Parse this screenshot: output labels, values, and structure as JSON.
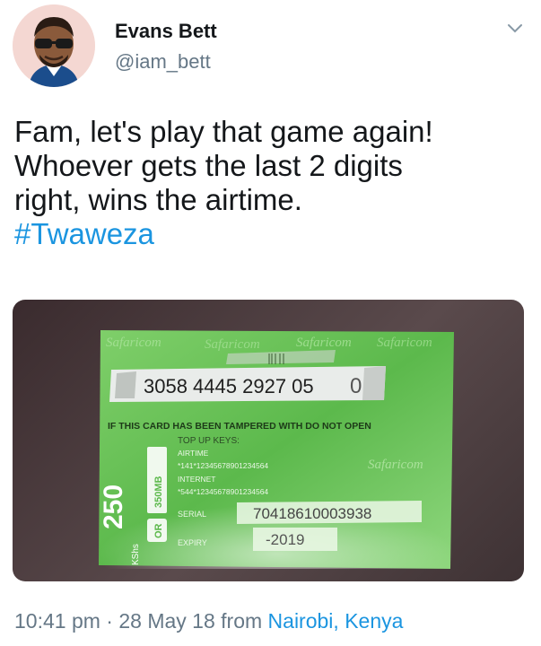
{
  "author": {
    "name": "Evans Bett",
    "handle": "@iam_bett"
  },
  "tweet": {
    "lines": [
      "Fam, let's play that game again!",
      "Whoever gets the last 2 digits",
      "right, wins the airtime."
    ],
    "hashtag": "#Twaweza"
  },
  "card": {
    "pin": "3058 4445 2927 05",
    "pin_last": "0",
    "warning": "IF THIS CARD HAS BEEN TAMPERED WITH DO NOT OPEN",
    "topup_keys": "TOP UP KEYS:",
    "airtime_label": "AIRTIME",
    "airtime_code": "*141*12345678901234564",
    "internet_label": "INTERNET",
    "internet_code": "*544*12345678901234564",
    "serial_label": "SERIAL",
    "serial": "70418610003938",
    "expiry_label": "EXPIRY",
    "expiry": "-2019",
    "amount": "250",
    "currency": "KShs",
    "or_label": "OR",
    "data_bundle": "350MB",
    "brand": "Safaricom"
  },
  "meta": {
    "time": "10:41 pm",
    "separator": " · ",
    "date": "28 May 18",
    "from": " from ",
    "location": "Nairobi, Kenya"
  },
  "icons": {
    "menu": "chevron-down-icon"
  }
}
